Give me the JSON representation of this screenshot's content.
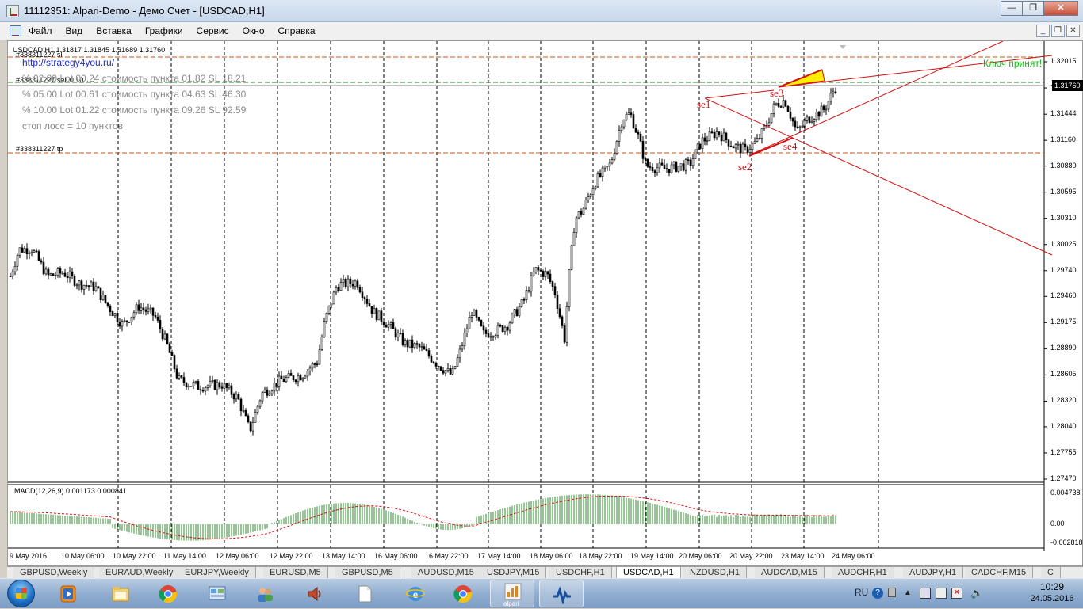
{
  "window": {
    "title": "11112351: Alpari-Demo - Демо Счет - [USDCAD,H1]",
    "buttons": [
      "minimize",
      "restore",
      "close"
    ]
  },
  "menu": {
    "items": [
      "Файл",
      "Вид",
      "Вставка",
      "Графики",
      "Сервис",
      "Окно",
      "Справка"
    ]
  },
  "chart": {
    "header": "USDCAD,H1  1.31817 1.31845 1.31689 1.31760",
    "link": "http://strategy4you.ru/",
    "order_sl_label": "#338311227 sl",
    "order_sell_label": "#338311227 sell 0.10",
    "order_tp_label": "#338311227 tp",
    "info_lines": [
      "% 02.00  Lot 00.24  стоимость пункта 01.82  SL 18.21",
      "% 05.00  Lot 00.61  стоимость пункта 04.63  SL 46.30",
      "% 10.00  Lot 01.22  стоимость пункта 09.26  SL 92.59",
      "стоп лосс = 10 пунктов"
    ],
    "key_message": "Ключ принят!",
    "pattern_labels": [
      "se1",
      "se2",
      "se3",
      "se4"
    ],
    "current_price": "1.31760",
    "price_axis": [
      "1.32015",
      "1.31730",
      "1.31444",
      "1.31160",
      "1.30880",
      "1.30595",
      "1.30310",
      "1.30025",
      "1.29740",
      "1.29460",
      "1.29175",
      "1.28890",
      "1.28605",
      "1.28320",
      "1.28040",
      "1.27755",
      "1.27470"
    ],
    "macd_label": "MACD(12,26,9) 0.001173 0.000841",
    "macd_axis": [
      "0.004738",
      "0.00",
      "-0.002818"
    ],
    "time_axis": [
      "9 May 2016",
      "10 May 06:00",
      "10 May 22:00",
      "11 May 14:00",
      "12 May 06:00",
      "12 May 22:00",
      "13 May 14:00",
      "16 May 06:00",
      "16 May 22:00",
      "17 May 14:00",
      "18 May 06:00",
      "18 May 22:00",
      "19 May 14:00",
      "20 May 06:00",
      "20 May 22:00",
      "23 May 14:00",
      "24 May 06:00"
    ],
    "colors": {
      "candle": "#000000",
      "trend_lines": "#d01010",
      "sl_tp_lines": "#d05010",
      "current_line": "#208020",
      "key_text": "#10c010",
      "highlight": "#ffee00",
      "macd_hist": "#2e8b2e",
      "macd_signal": "#d01010"
    }
  },
  "tabs": [
    "GBPUSD,Weekly",
    "EURAUD,Weekly",
    "EURJPY,Weekly",
    "EURUSD,M5",
    "GBPUSD,M5",
    "AUDUSD,M15",
    "USDJPY,M15",
    "USDCHF,H1",
    "USDCAD,H1",
    "NZDUSD,H1",
    "AUDCAD,M15",
    "AUDCHF,H1",
    "AUDJPY,H1",
    "CADCHF,M15",
    "C"
  ],
  "active_tab": "USDCAD,H1",
  "taskbar": {
    "apps": [
      "media-player-icon",
      "explorer-icon",
      "chrome-icon",
      "control-panel-icon",
      "users-icon",
      "volume-app-icon",
      "blank-doc-icon",
      "ie-icon",
      "chrome-icon-2",
      "alpari-icon",
      "metatrader-icon"
    ],
    "alpari_label": "alpari",
    "language": "RU",
    "time": "10:29",
    "date": "24.05.2016"
  }
}
